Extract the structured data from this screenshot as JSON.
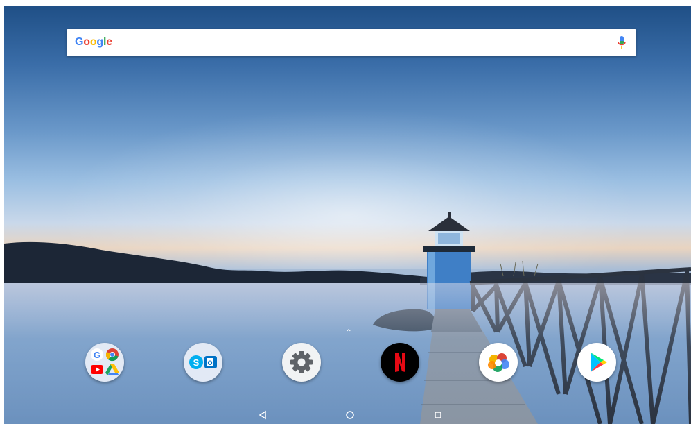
{
  "search": {
    "logo_letters": [
      "G",
      "o",
      "o",
      "g",
      "l",
      "e"
    ],
    "logo_colors": [
      "#4285F4",
      "#EA4335",
      "#FBBC05",
      "#4285F4",
      "#34A853",
      "#EA4335"
    ],
    "mic_icon": "mic-icon"
  },
  "dock": {
    "apps_indicator_icon": "chevron-up-icon",
    "apps": [
      {
        "name": "google-apps-folder",
        "icons": [
          "google-icon",
          "chrome-icon",
          "youtube-icon",
          "drive-icon"
        ]
      },
      {
        "name": "microsoft-folder",
        "icons": [
          "skype-icon",
          "outlook-icon"
        ]
      },
      {
        "name": "settings-app",
        "icon": "gear-icon"
      },
      {
        "name": "netflix-app",
        "icon": "netflix-icon",
        "text": "N"
      },
      {
        "name": "photos-app",
        "icon": "flower-icon"
      },
      {
        "name": "play-store-app",
        "icon": "play-store-icon"
      }
    ]
  },
  "nav": {
    "buttons": [
      "back-icon",
      "home-icon",
      "recents-icon"
    ]
  },
  "colors": {
    "netflix_red": "#E50914",
    "skype_blue": "#00AFF0",
    "outlook_blue": "#0072C6"
  }
}
